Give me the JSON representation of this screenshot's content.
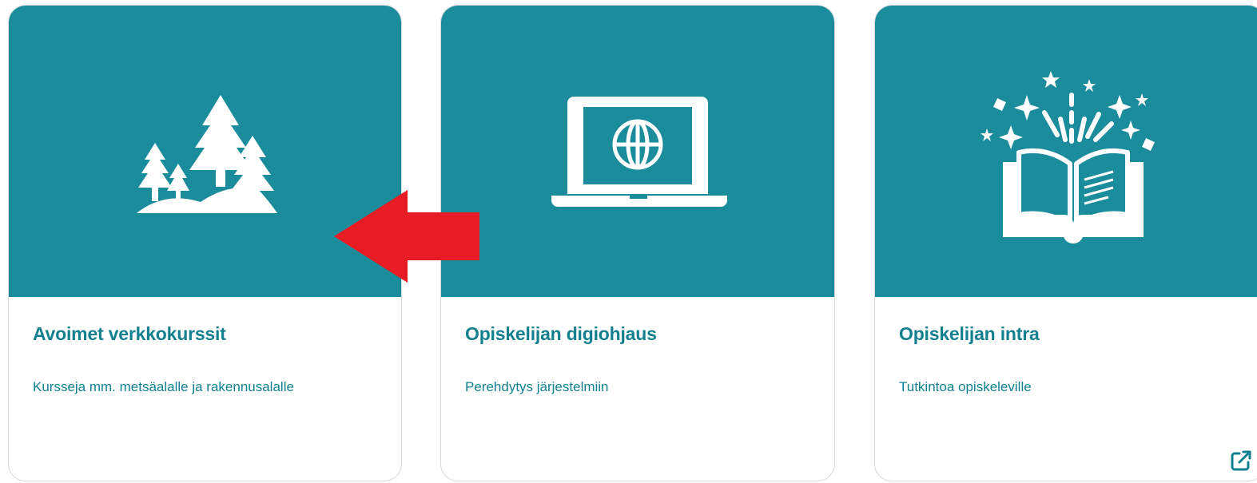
{
  "theme": {
    "image_bg": "#1b8c9c",
    "title_color": "#12808f",
    "text_color": "#12808f",
    "illustration_color": "#ffffff",
    "arrow_color": "#e81c24"
  },
  "cards": [
    {
      "title": "Avoimet verkkokurssit",
      "description": "Kursseja mm. metsäalalle ja rakennusalalle",
      "icon": "forest-icon"
    },
    {
      "title": "Opiskelijan digiohjaus",
      "description": "Perehdytys järjestelmiin",
      "icon": "laptop-globe-icon"
    },
    {
      "title": "Opiskelijan intra",
      "description": "Tutkintoa opiskeleville",
      "icon": "open-book-sparkles-icon",
      "external_link_icon": "external-link-icon"
    }
  ],
  "annotation": {
    "icon": "red-arrow-left-icon"
  }
}
